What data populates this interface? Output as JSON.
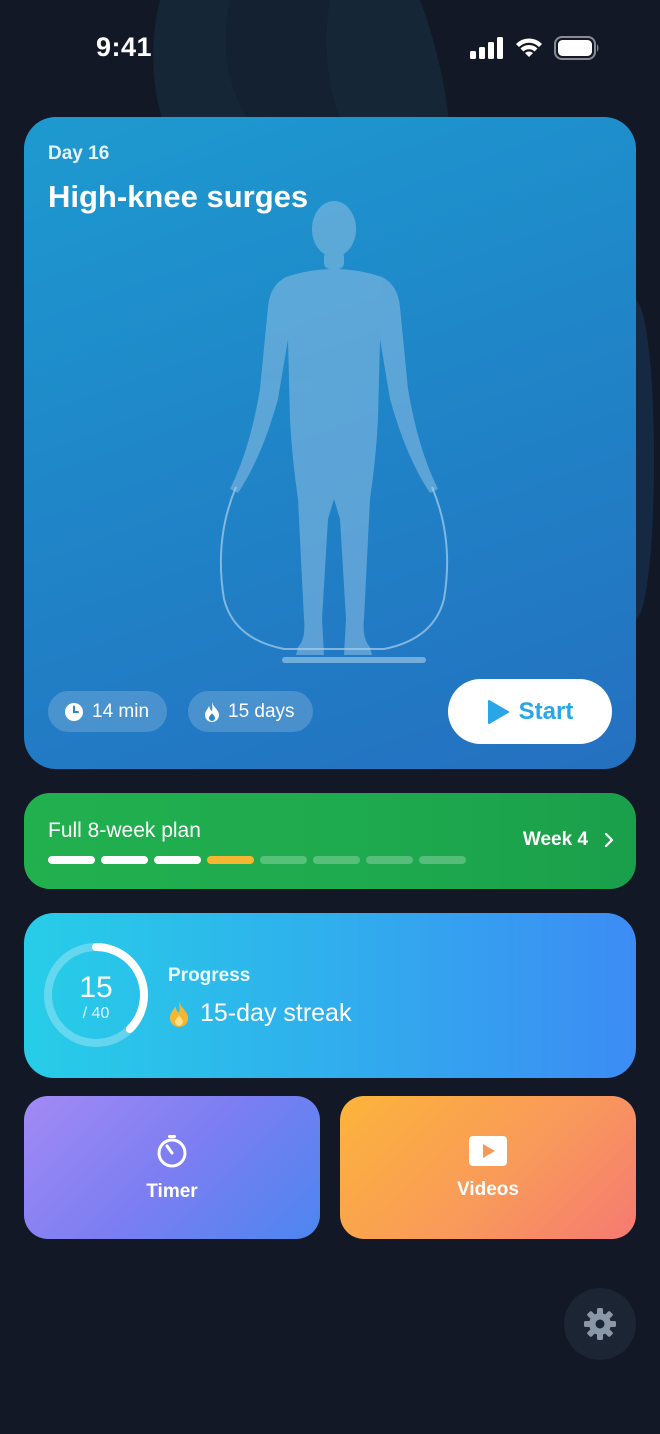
{
  "status_bar": {
    "time": "9:41"
  },
  "hero": {
    "day_label": "Day 16",
    "title": "High-knee surges",
    "duration": "14 min",
    "streak": "15 days",
    "start_label": "Start"
  },
  "plan": {
    "title": "Full 8-week plan",
    "week_label": "Week 4",
    "total_weeks": 8,
    "completed_weeks": 3,
    "current_week": 4
  },
  "progress": {
    "label": "Progress",
    "value": "15",
    "total": "/ 40",
    "fraction": 0.375,
    "streak_text": "15-day streak"
  },
  "tiles": {
    "timer_label": "Timer",
    "videos_label": "Videos"
  },
  "icons": {
    "status": [
      "signal-icon",
      "wifi-icon",
      "battery-icon"
    ],
    "hero": [
      "clock-icon",
      "flame-icon",
      "play-icon"
    ],
    "plan": [
      "chevron-right-icon"
    ],
    "tiles": [
      "stopwatch-icon",
      "video-play-icon"
    ],
    "settings": "gear-icon"
  },
  "colors": {
    "background": "#121826",
    "hero_accent": "#2aa6e8",
    "plan_green": "#1ea94e",
    "current_week": "#f5b731",
    "streak_flame": "#f5b731"
  }
}
